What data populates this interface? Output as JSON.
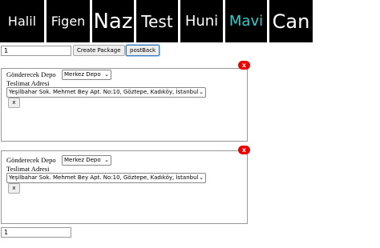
{
  "tabs": [
    {
      "label": "Halil"
    },
    {
      "label": "Figen"
    },
    {
      "label": "Naz"
    },
    {
      "label": "Test"
    },
    {
      "label": "Huni"
    },
    {
      "label": "Mavi"
    },
    {
      "label": "Can"
    }
  ],
  "toolbar": {
    "count_value": "1",
    "create_label": "Create Package",
    "postback_label": "postBack"
  },
  "packages": [
    {
      "close_label": "x",
      "depot_label": "Gönderecek Depo",
      "depot_value": "Merkez Depo",
      "address_label": "Teslimat Adresi",
      "address_value": "Yeşilbahar Sok. Mehmet Bey Apt. No:10, Göztepe, Kadıköy, İstanbul",
      "remove_label": "x"
    },
    {
      "close_label": "x",
      "depot_label": "Gönderecek Depo",
      "depot_value": "Merkez Depo",
      "address_label": "Teslimat Adresi",
      "address_value": "Yeşilbahar Sok. Mehmet Bey Apt. No:10, Göztepe, Kadıköy, İstanbul",
      "remove_label": "x"
    }
  ],
  "footer": {
    "value": "1"
  },
  "colors": {
    "tab_bg": "#000000",
    "tab_text": "#ffffff",
    "active_tab_text": "#33cccc",
    "close_bg": "#ee0000"
  }
}
